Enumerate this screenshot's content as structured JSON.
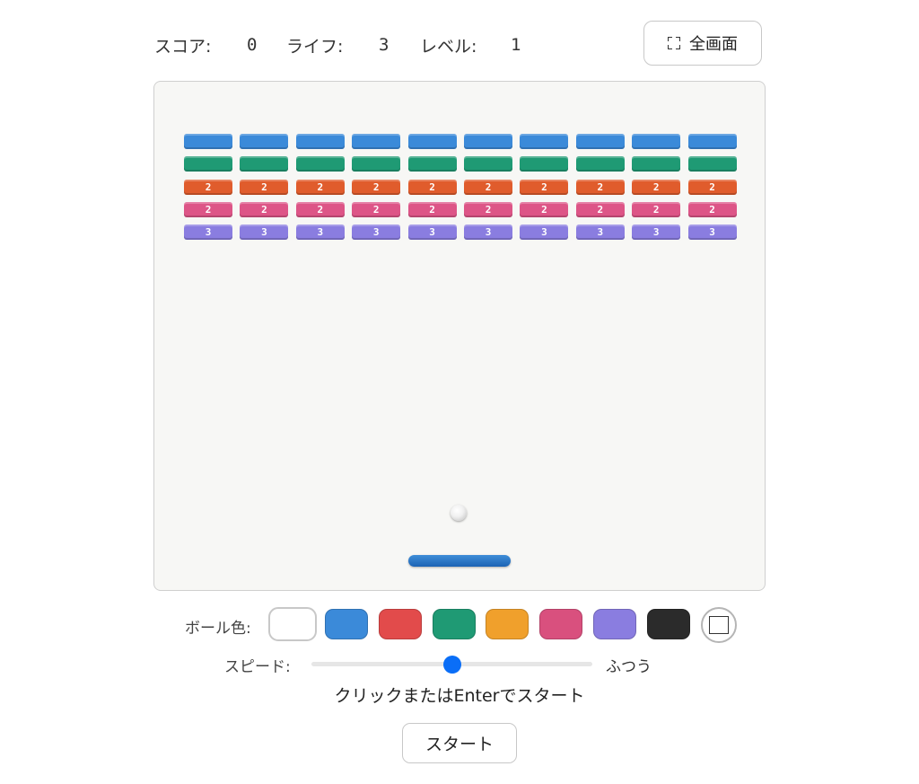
{
  "hud": {
    "score_label": "スコア:",
    "score_value": "0",
    "lives_label": "ライフ:",
    "lives_value": "3",
    "level_label": "レベル:",
    "level_value": "1",
    "fullscreen_label": "全画面",
    "fullscreen_icon": "fullscreen-icon"
  },
  "bricks": {
    "columns": 10,
    "rows": [
      {
        "color": "#3b8ad9",
        "labels": [
          "",
          "",
          "",
          "",
          "",
          "",
          "",
          "",
          "",
          ""
        ]
      },
      {
        "color": "#1f9a74",
        "labels": [
          "",
          "",
          "",
          "",
          "",
          "",
          "",
          "",
          "",
          ""
        ]
      },
      {
        "color": "#e05c2c",
        "labels": [
          "2",
          "2",
          "2",
          "2",
          "2",
          "2",
          "2",
          "2",
          "2",
          "2"
        ]
      },
      {
        "color": "#dd5587",
        "labels": [
          "2",
          "2",
          "2",
          "2",
          "2",
          "2",
          "2",
          "2",
          "2",
          "2"
        ]
      },
      {
        "color": "#8a7de0",
        "labels": [
          "3",
          "3",
          "3",
          "3",
          "3",
          "3",
          "3",
          "3",
          "3",
          "3"
        ]
      }
    ]
  },
  "ball_colors": {
    "label": "ボール色:",
    "swatches": [
      "#ffffff",
      "#3b8ad9",
      "#e24b4b",
      "#1f9a74",
      "#f0a02c",
      "#d9507e",
      "#8a7de0",
      "#2b2b2b"
    ],
    "selected_index": 0,
    "custom_icon": "color-picker-icon"
  },
  "speed": {
    "label": "スピード:",
    "value_text": "ふつう",
    "level_fraction": 0.5
  },
  "hint": "クリックまたはEnterでスタート",
  "start_label": "スタート",
  "colors": {
    "accent": "#0a6ef7",
    "paddle": "#2a74c5"
  }
}
